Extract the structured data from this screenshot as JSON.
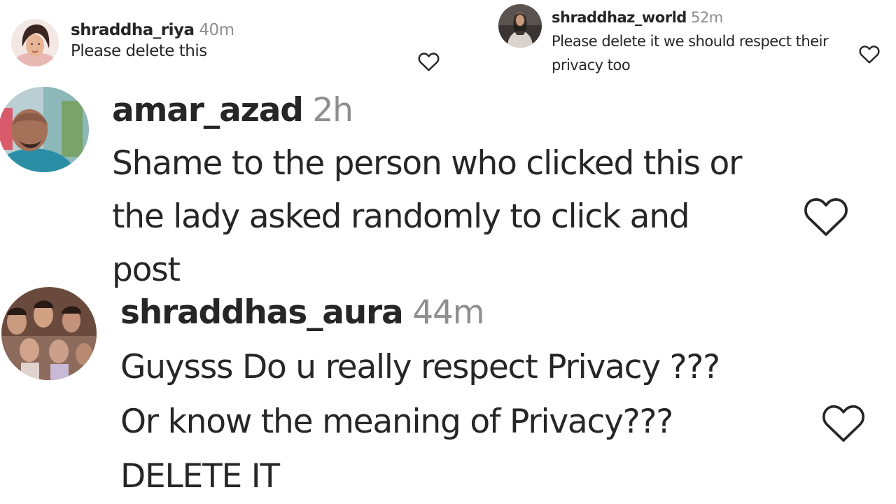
{
  "comments": [
    {
      "username": "shraddha_riya",
      "time": "40m",
      "text": "Please delete this",
      "like_icon": "heart-outline-icon"
    },
    {
      "username": "shraddhaz_world",
      "time": "52m",
      "text": "Please delete it we should respect their privacy too",
      "like_icon": "heart-outline-icon"
    },
    {
      "username": "amar_azad",
      "time": "2h",
      "text": "Shame to the person who clicked this or the lady asked randomly to click and post",
      "like_icon": "heart-outline-icon"
    },
    {
      "username": "shraddhas_aura",
      "time": "44m",
      "text": "Guysss Do u really respect Privacy ??? Or know the meaning of Privacy??? DELETE IT",
      "like_icon": "heart-outline-icon"
    }
  ],
  "colors": {
    "background": "#ffffff",
    "username": "#262626",
    "timestamp": "#8e8e8e",
    "text": "#262626",
    "icon": "#262626"
  }
}
